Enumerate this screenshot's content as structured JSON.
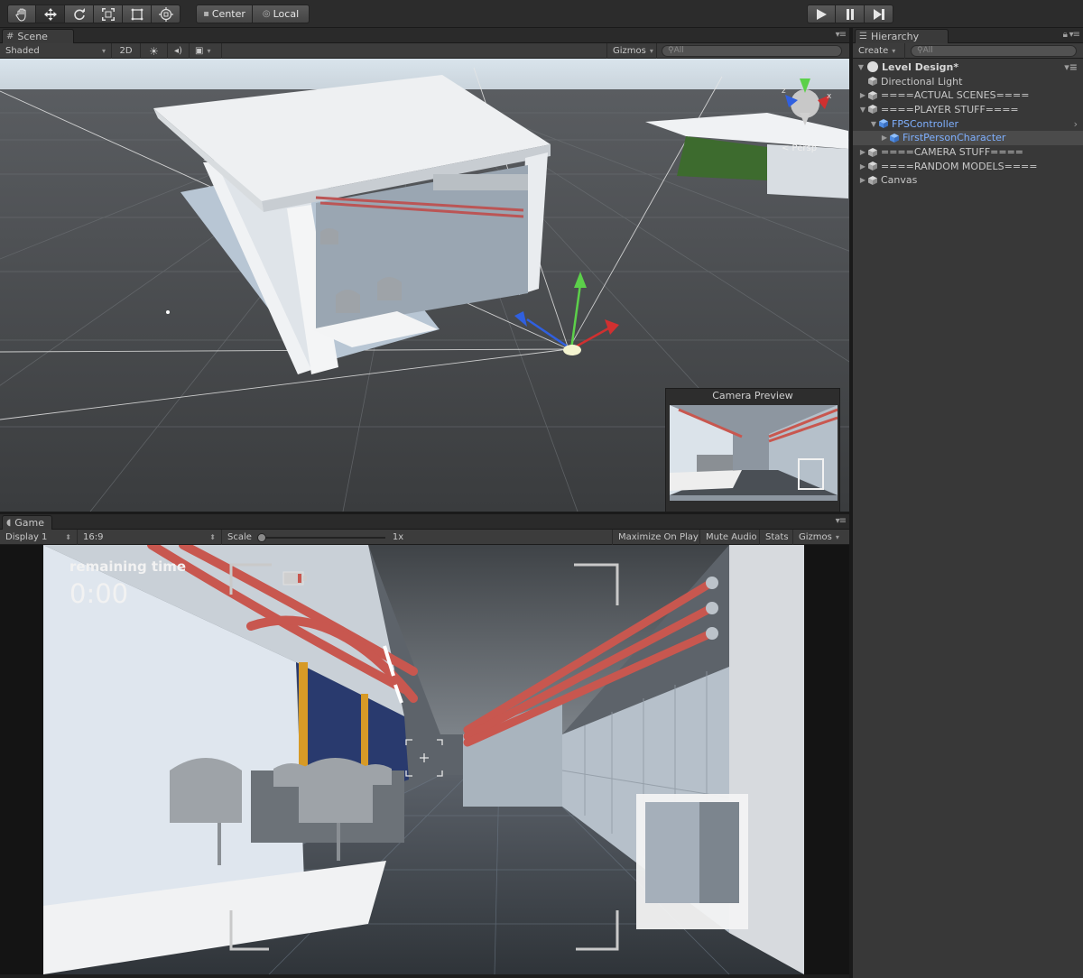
{
  "toolbar": {
    "tools": [
      "hand-icon",
      "move-icon",
      "rotate-icon",
      "scale-icon",
      "rect-icon",
      "transform-icon"
    ],
    "pivot_label": "Center",
    "space_label": "Local",
    "playback": [
      "play-icon",
      "pause-icon",
      "step-icon"
    ]
  },
  "scene": {
    "tab_label": "Scene",
    "shading_mode": "Shaded",
    "mode_2d": "2D",
    "gizmos_label": "Gizmos",
    "search_placeholder": "All",
    "orientation_label": "< Persp",
    "gizmo_axes": {
      "y": "y",
      "x": "x",
      "z": "z"
    },
    "camera_preview_title": "Camera Preview"
  },
  "game": {
    "tab_label": "Game",
    "display": "Display 1",
    "aspect": "16:9",
    "scale_label": "Scale",
    "scale_value": "1x",
    "maximize_on_play": "Maximize On Play",
    "mute_audio": "Mute Audio",
    "stats": "Stats",
    "gizmos_label": "Gizmos",
    "hud": {
      "remaining_label": "remaining time",
      "time_value": "0:00"
    }
  },
  "hierarchy": {
    "tab_label": "Hierarchy",
    "create_label": "Create",
    "search_placeholder": "All",
    "scene_name": "Level Design*",
    "items": [
      {
        "label": "Directional Light",
        "expandable": false,
        "indent": 1
      },
      {
        "label": "====ACTUAL SCENES====",
        "expandable": true,
        "expanded": false,
        "indent": 1
      },
      {
        "label": "====PLAYER STUFF====",
        "expandable": true,
        "expanded": true,
        "indent": 1
      },
      {
        "label": "FPSController",
        "expandable": true,
        "expanded": true,
        "indent": 2,
        "prefab": true
      },
      {
        "label": "FirstPersonCharacter",
        "expandable": true,
        "expanded": false,
        "indent": 3,
        "prefab": true,
        "selected": true
      },
      {
        "label": "====CAMERA STUFF====",
        "expandable": true,
        "expanded": false,
        "indent": 1
      },
      {
        "label": "====RANDOM MODELS====",
        "expandable": true,
        "expanded": false,
        "indent": 1
      },
      {
        "label": "Canvas",
        "expandable": true,
        "expanded": false,
        "indent": 1
      }
    ]
  },
  "colors": {
    "prefab_text": "#7fb0ff",
    "axis_x": "#d03030",
    "axis_y": "#5cd04a",
    "axis_z": "#3060e0",
    "pipe": "#c8574f",
    "pillar": "#d79a26"
  }
}
